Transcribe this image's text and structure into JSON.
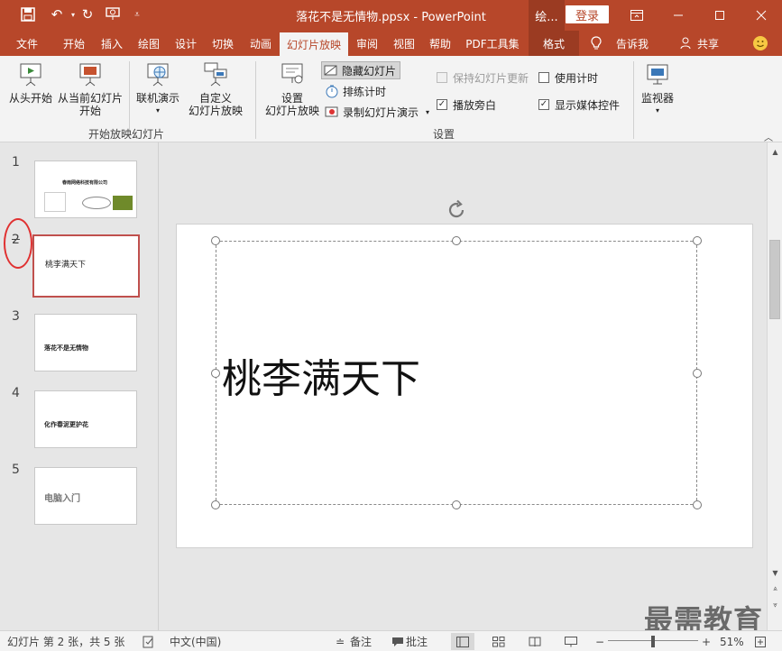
{
  "window": {
    "title": "落花不是无情物.ppsx  -  PowerPoint",
    "tool_label": "绘...",
    "login_label": "登录"
  },
  "tabs": [
    {
      "label": "文件"
    },
    {
      "label": "开始"
    },
    {
      "label": "插入"
    },
    {
      "label": "绘图"
    },
    {
      "label": "设计"
    },
    {
      "label": "切换"
    },
    {
      "label": "动画"
    },
    {
      "label": "幻灯片放映"
    },
    {
      "label": "审阅"
    },
    {
      "label": "视图"
    },
    {
      "label": "帮助"
    },
    {
      "label": "PDF工具集"
    },
    {
      "label": "格式"
    }
  ],
  "tellme": "告诉我",
  "share": "共享",
  "ribbon": {
    "start_group": {
      "from_beginning": "从头开始",
      "from_current_line1": "从当前幻灯片",
      "from_current_line2": "开始",
      "online_present": "联机演示",
      "custom_line1": "自定义",
      "custom_line2": "幻灯片放映",
      "label": "开始放映幻灯片"
    },
    "setup_group": {
      "setup_line1": "设置",
      "setup_line2": "幻灯片放映",
      "hide_slide": "隐藏幻灯片",
      "rehearse": "排练计时",
      "record": "录制幻灯片演示",
      "keep_updated": "保持幻灯片更新",
      "play_narration": "播放旁白",
      "use_timings": "使用计时",
      "show_media_controls": "显示媒体控件",
      "label": "设置"
    },
    "monitor_group": {
      "monitor": "监视器"
    }
  },
  "slides": [
    {
      "num": "1",
      "text": "春雨网络科技有限公司"
    },
    {
      "num": "2",
      "text": "桃李满天下"
    },
    {
      "num": "3",
      "text": "落花不是无情物"
    },
    {
      "num": "4",
      "text": "化作春泥更护花"
    },
    {
      "num": "5",
      "text": "电脑入门"
    }
  ],
  "current_slide": {
    "title": "桃李满天下"
  },
  "status": {
    "slide_info": "幻灯片 第 2 张，共 5 张",
    "language": "中文(中国)",
    "notes": "备注",
    "comments": "批注",
    "zoom": "51%"
  },
  "watermark": "最需教育",
  "colors": {
    "accent": "#b7472a",
    "annotation": "#e03131"
  }
}
